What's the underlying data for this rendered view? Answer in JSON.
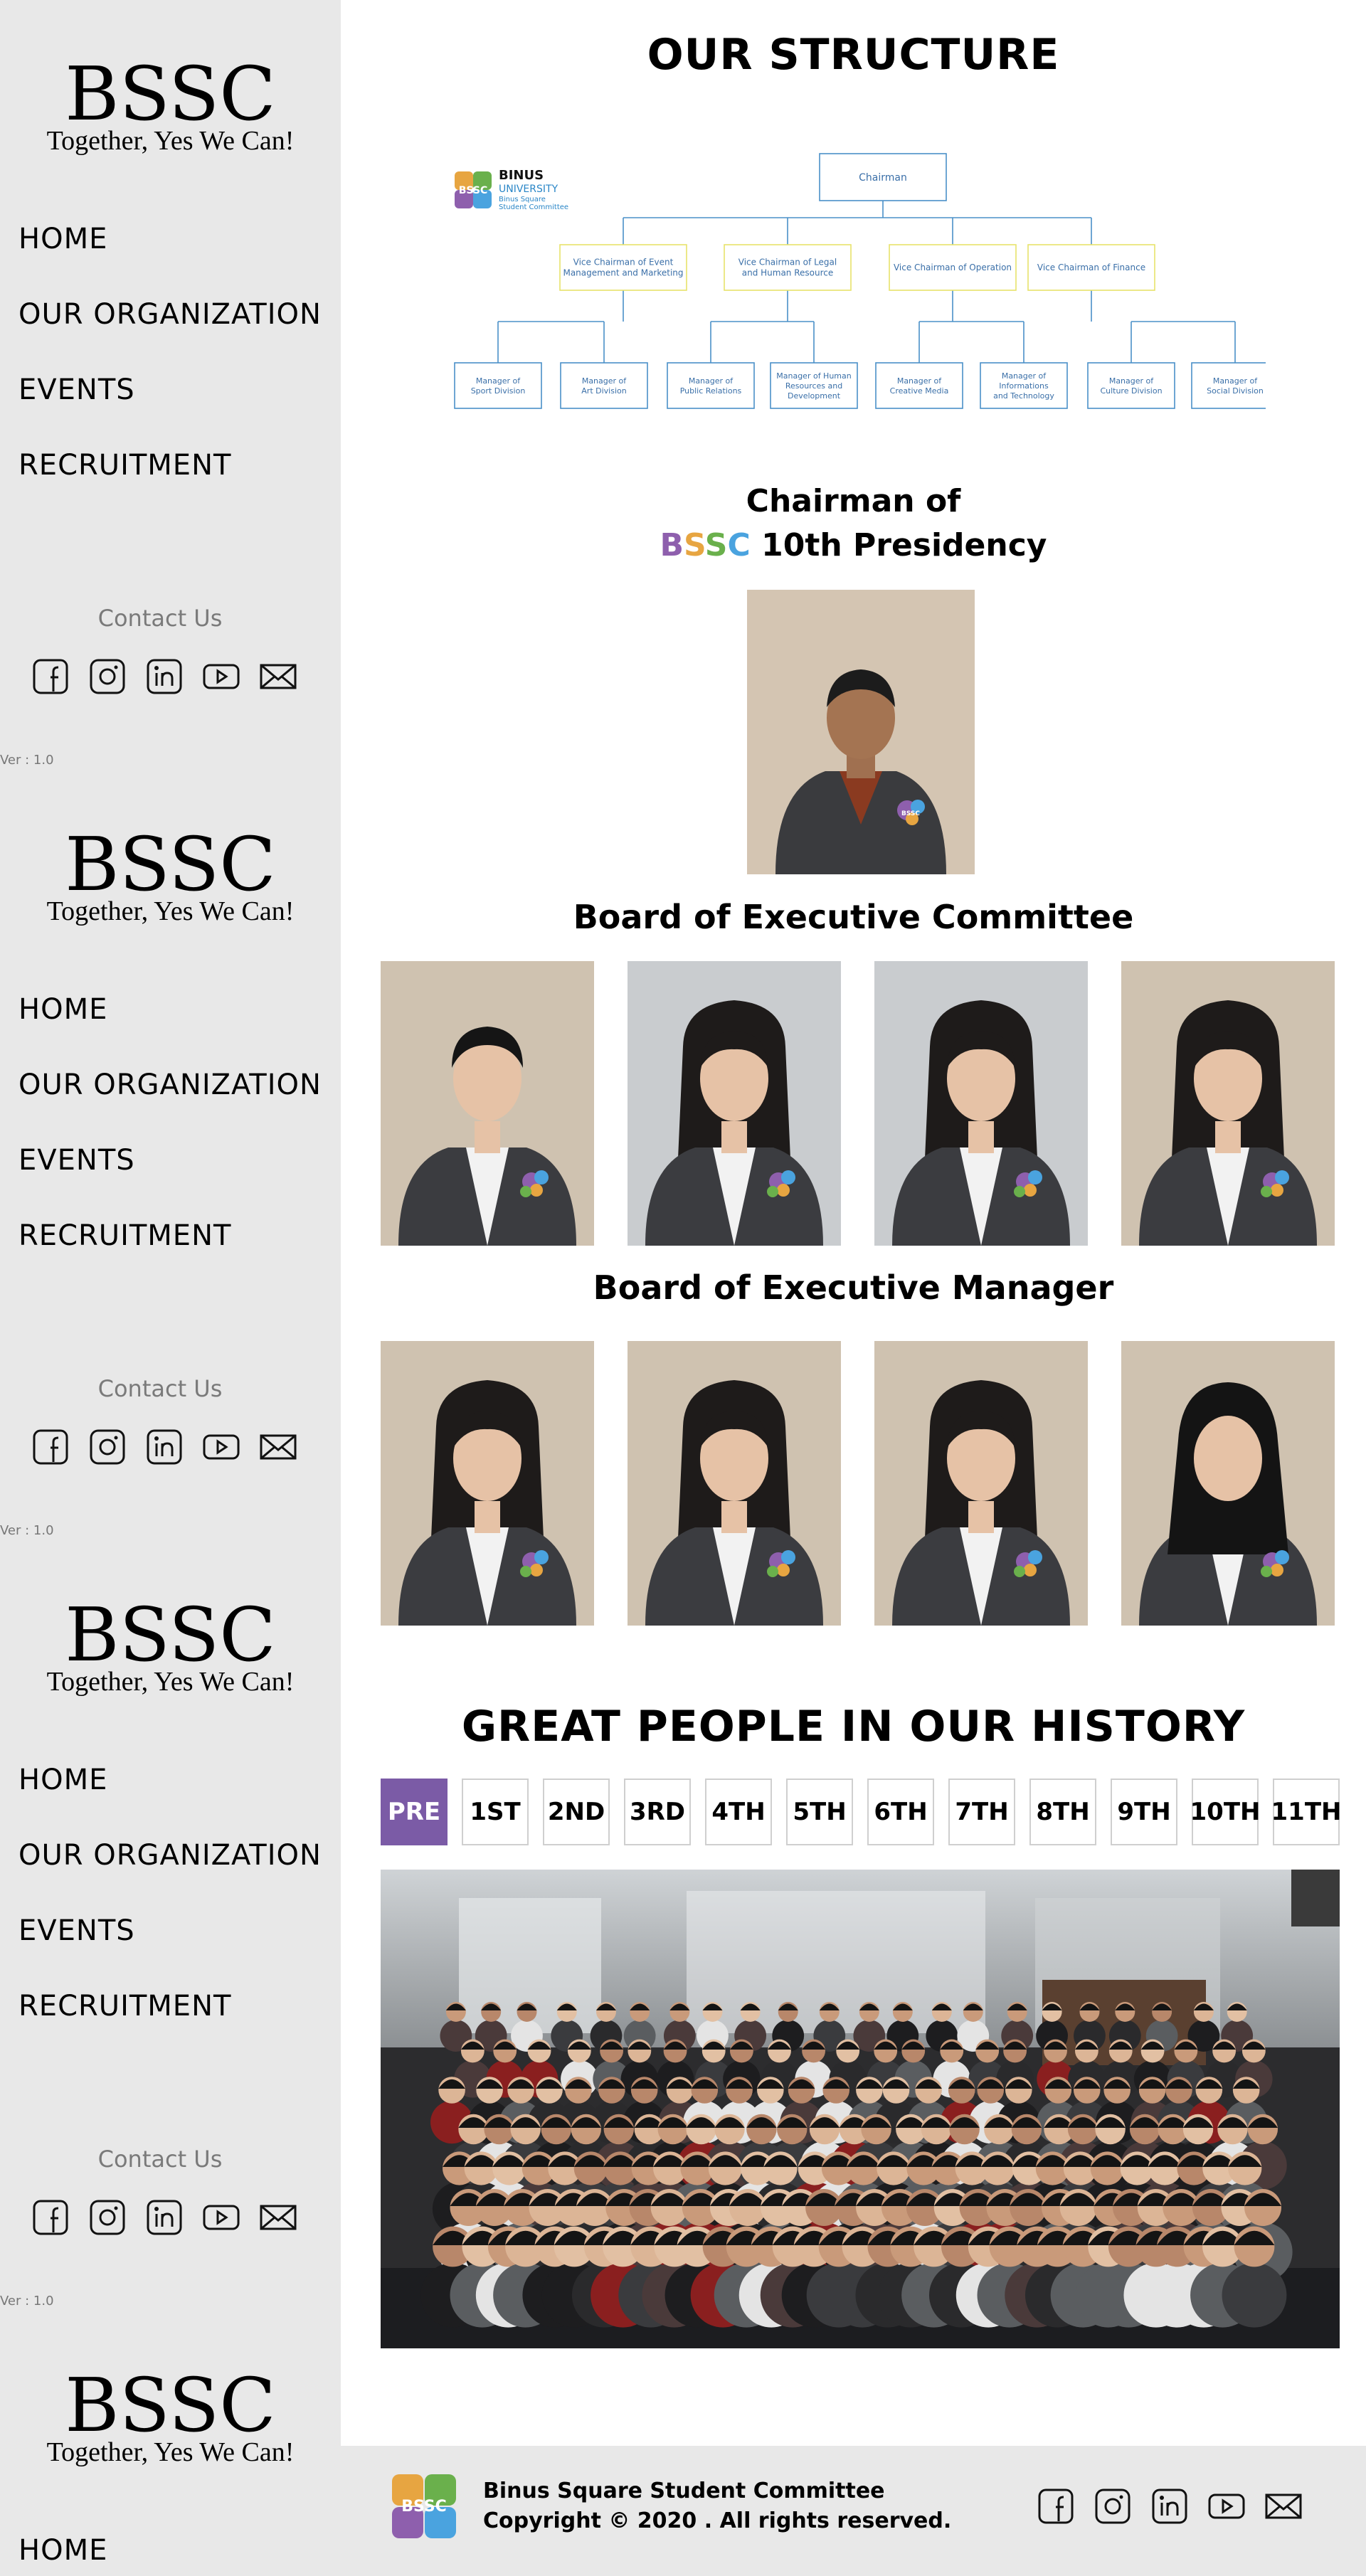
{
  "sidebar": {
    "logo": "BSSC",
    "slogan": "Together, Yes We Can!",
    "nav": [
      "HOME",
      "OUR ORGANIZATION",
      "EVENTS",
      "RECRUITMENT"
    ],
    "contact_title": "Contact Us",
    "social_icons": [
      "facebook-icon",
      "instagram-icon",
      "linkedin-icon",
      "youtube-icon",
      "mail-icon"
    ],
    "version": "Ver : 1.0"
  },
  "structure": {
    "title": "OUR STRUCTURE",
    "logo_text": {
      "line1": "BINUS",
      "line2": "UNIVERSITY",
      "line3": "Binus Square",
      "line4": "Student Committee"
    },
    "chairman": "Chairman",
    "vice_chairmen": [
      [
        "Vice Chairman of Event",
        "Management and Marketing"
      ],
      [
        "Vice Chairman of Legal",
        "and Human Resource"
      ],
      [
        "Vice Chairman of Operation"
      ],
      [
        "Vice Chairman of Finance"
      ]
    ],
    "managers": [
      [
        "Manager of",
        "Sport Division"
      ],
      [
        "Manager of",
        "Art Division"
      ],
      [
        "Manager of",
        "Public Relations"
      ],
      [
        "Manager of Human",
        "Resources and",
        "Development"
      ],
      [
        "Manager of",
        "Creative Media"
      ],
      [
        "Manager of",
        "Informations",
        "and Technology"
      ],
      [
        "Manager of",
        "Culture Division"
      ],
      [
        "Manager of",
        "Social Division"
      ]
    ]
  },
  "chairman_section": {
    "line1": "Chairman of",
    "bssc_letters": [
      "B",
      "S",
      "S",
      "C"
    ],
    "line2_suffix": " 10th Presidency",
    "badge_text": "BSSC"
  },
  "boec": {
    "title": "Board of Executive Committee"
  },
  "boem": {
    "title": "Board of Executive Manager"
  },
  "history": {
    "title": "GREAT PEOPLE IN OUR HISTORY",
    "tabs": [
      "PRE",
      "1ST",
      "2ND",
      "3RD",
      "4TH",
      "5TH",
      "6TH",
      "7TH",
      "8TH",
      "9TH",
      "10TH",
      "11TH"
    ],
    "active_tab": "PRE"
  },
  "footer": {
    "name": "Binus Square Student Committee",
    "copyright": "Copyright © 2020 . All rights reserved.",
    "logo_text": "BSSC",
    "social_icons": [
      "facebook-icon",
      "instagram-icon",
      "linkedin-icon",
      "youtube-icon",
      "mail-icon"
    ]
  },
  "colors": {
    "sidebar_bg": "#e8e8e8",
    "accent_purple": "#7b5ba6",
    "org_blue": "#4a90c8",
    "org_yellow": "#e8e36b",
    "bssc_b": "#8e5fad",
    "bssc_s1": "#e7a541",
    "bssc_s2": "#6ab04c",
    "bssc_c": "#4aa3df"
  }
}
